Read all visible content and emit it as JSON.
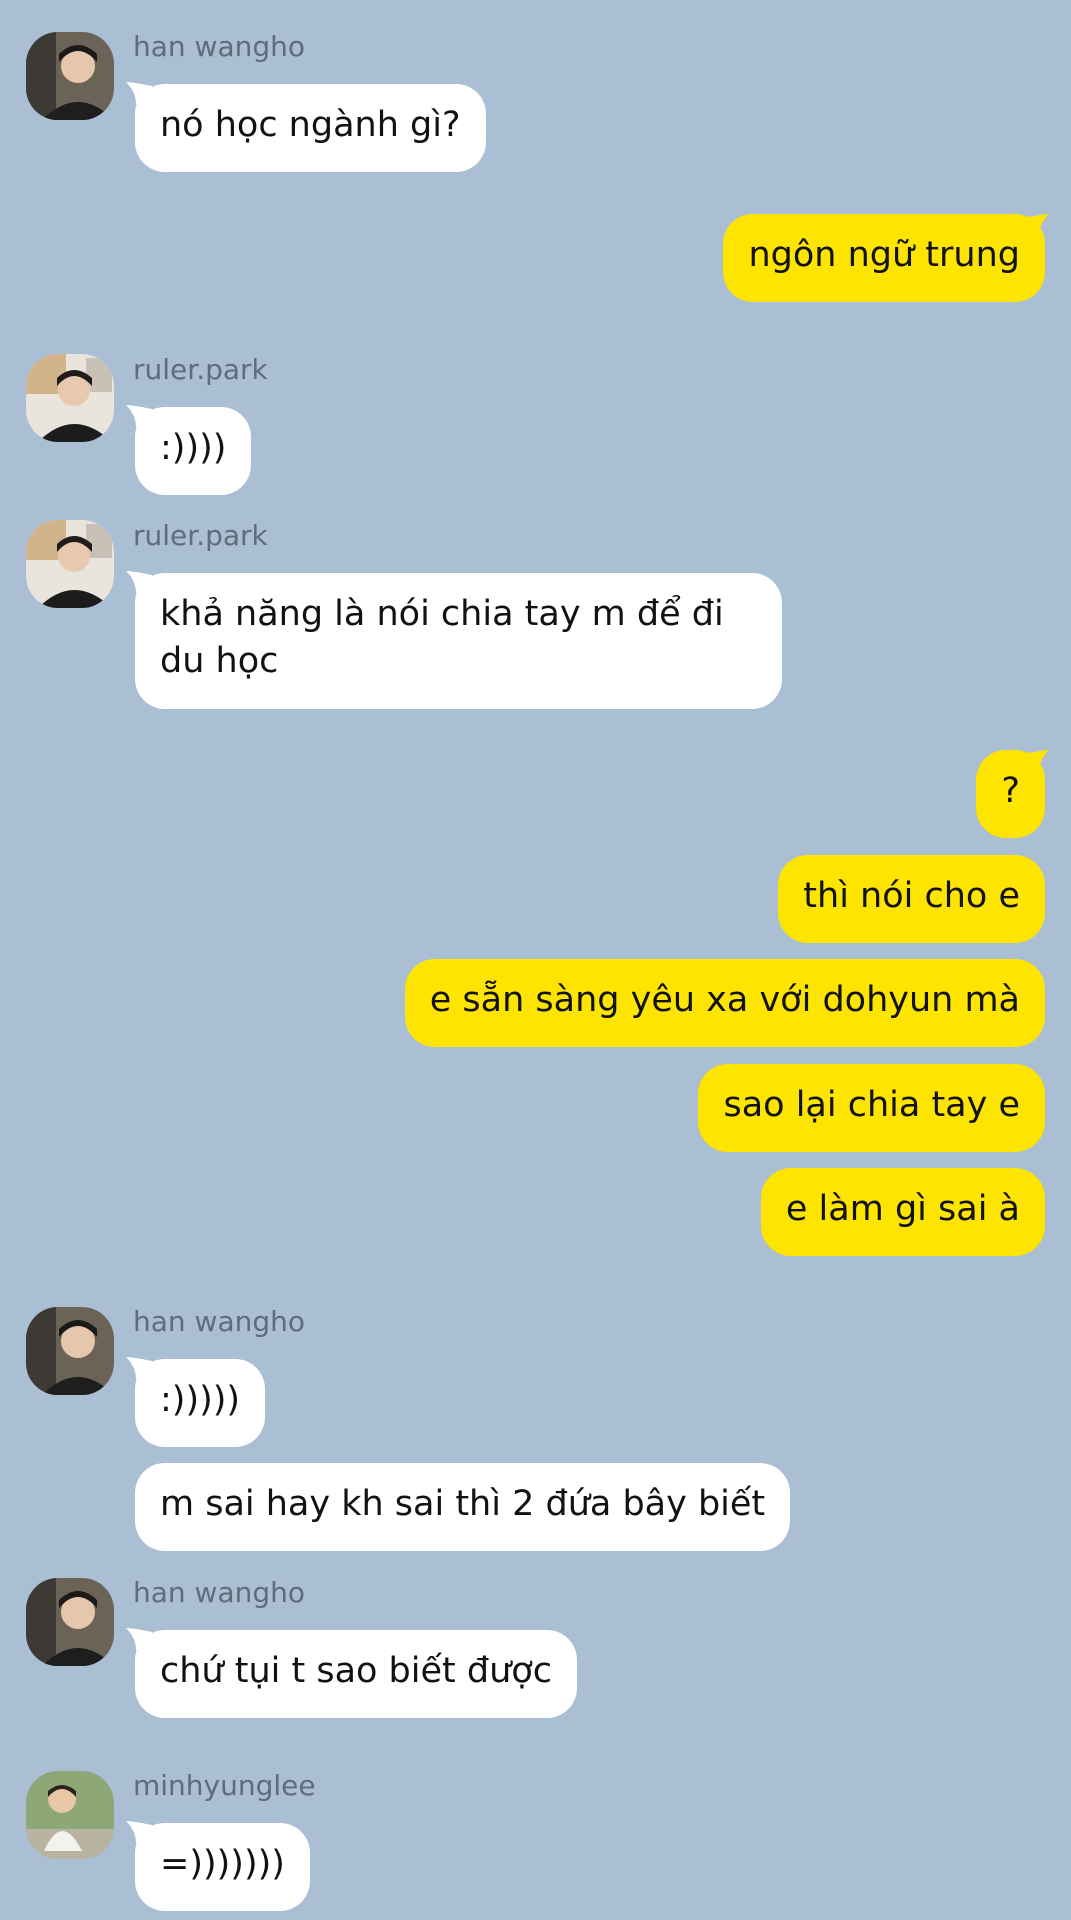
{
  "colors": {
    "background": "#abbfd4",
    "incoming_bubble": "#ffffff",
    "outgoing_bubble": "#fde401",
    "sender_name": "#5f6c7a",
    "message_text": "#121212"
  },
  "messages": [
    {
      "sender": "han wangho",
      "avatar": "han-wangho-avatar",
      "text": "nó học ngành gì?"
    },
    {
      "sender": "me",
      "text": "ngôn ngữ trung"
    },
    {
      "sender": "ruler.park",
      "avatar": "ruler-park-avatar",
      "text": ":))))"
    },
    {
      "sender": "ruler.park",
      "avatar": "ruler-park-avatar",
      "text": "khả năng là nói chia tay m để đi du học"
    },
    {
      "sender": "me",
      "text": "?"
    },
    {
      "sender": "me",
      "text": "thì nói cho e"
    },
    {
      "sender": "me",
      "text": "e sẵn sàng yêu xa với dohyun mà"
    },
    {
      "sender": "me",
      "text": "sao lại chia tay e"
    },
    {
      "sender": "me",
      "text": "e làm gì sai à"
    },
    {
      "sender": "han wangho",
      "avatar": "han-wangho-avatar",
      "text": ":)))))"
    },
    {
      "sender": "han wangho",
      "text": "m sai hay kh sai thì 2 đứa bây biết"
    },
    {
      "sender": "han wangho",
      "avatar": "han-wangho-avatar",
      "text": "chứ tụi t sao biết được"
    },
    {
      "sender": "minhyunglee",
      "avatar": "minhyunglee-avatar",
      "text": "=)))))))"
    }
  ]
}
